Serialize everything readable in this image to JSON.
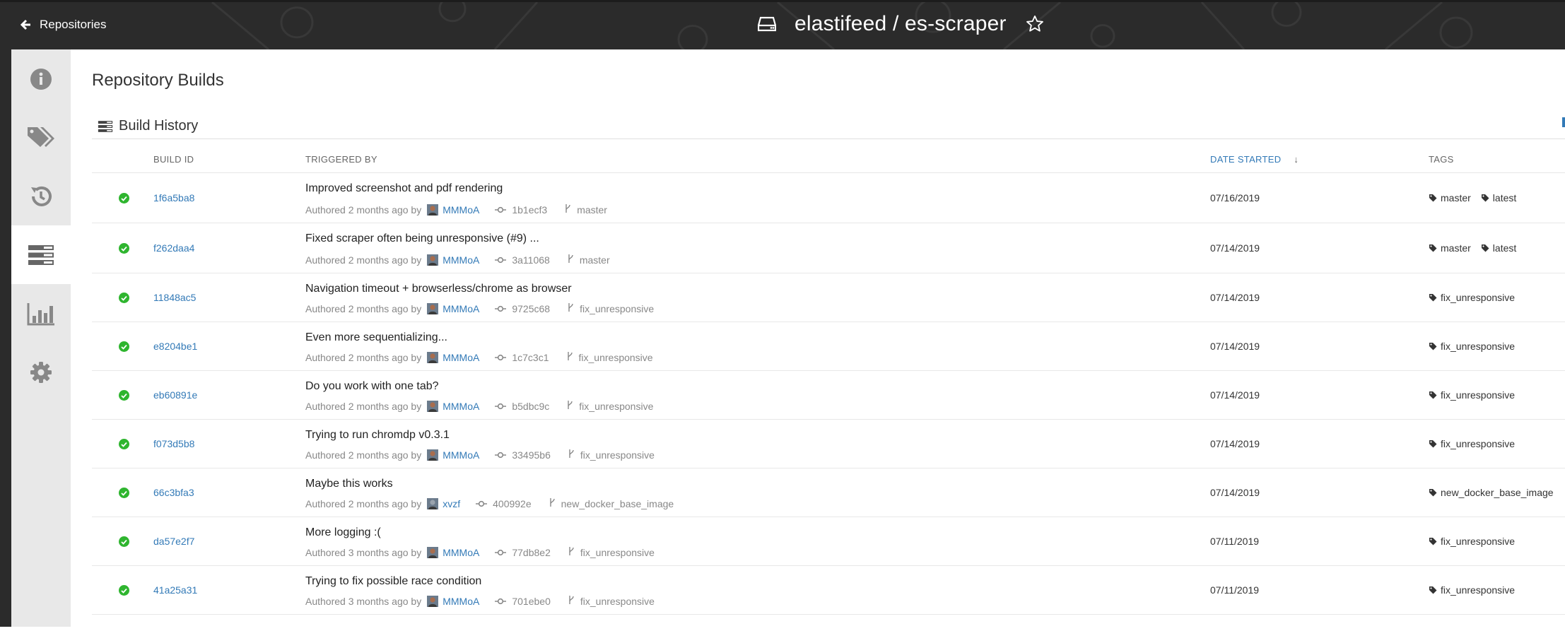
{
  "nav": {
    "back_label": "Repositories"
  },
  "header": {
    "repo_title": "elastifeed / es-scraper"
  },
  "sidebar": {
    "items": [
      {
        "icon": "info-icon"
      },
      {
        "icon": "tags-icon"
      },
      {
        "icon": "history-icon"
      },
      {
        "icon": "builds-icon",
        "active": true
      },
      {
        "icon": "bar-chart-icon"
      },
      {
        "icon": "gear-icon"
      }
    ]
  },
  "page": {
    "title": "Repository Builds"
  },
  "build_history": {
    "title": "Build History",
    "columns": {
      "build_id": "BUILD ID",
      "triggered_by": "TRIGGERED BY",
      "date_started": "DATE STARTED",
      "sort_indicator": "↓",
      "tags": "TAGS"
    },
    "rows": [
      {
        "id": "1f6a5ba8",
        "message": "Improved screenshot and pdf rendering",
        "authored": "Authored 2 months ago by",
        "author": "MMMoA",
        "commit": "1b1ecf3",
        "branch": "master",
        "date": "07/16/2019",
        "tags": [
          "master",
          "latest"
        ]
      },
      {
        "id": "f262daa4",
        "message": "Fixed scraper often being unresponsive (#9) ...",
        "authored": "Authored 2 months ago by",
        "author": "MMMoA",
        "commit": "3a11068",
        "branch": "master",
        "date": "07/14/2019",
        "tags": [
          "master",
          "latest"
        ]
      },
      {
        "id": "11848ac5",
        "message": "Navigation timeout + browserless/chrome as browser",
        "authored": "Authored 2 months ago by",
        "author": "MMMoA",
        "commit": "9725c68",
        "branch": "fix_unresponsive",
        "date": "07/14/2019",
        "tags": [
          "fix_unresponsive"
        ]
      },
      {
        "id": "e8204be1",
        "message": "Even more sequentializing...",
        "authored": "Authored 2 months ago by",
        "author": "MMMoA",
        "commit": "1c7c3c1",
        "branch": "fix_unresponsive",
        "date": "07/14/2019",
        "tags": [
          "fix_unresponsive"
        ]
      },
      {
        "id": "eb60891e",
        "message": "Do you work with one tab?",
        "authored": "Authored 2 months ago by",
        "author": "MMMoA",
        "commit": "b5dbc9c",
        "branch": "fix_unresponsive",
        "date": "07/14/2019",
        "tags": [
          "fix_unresponsive"
        ]
      },
      {
        "id": "f073d5b8",
        "message": "Trying to run chromdp v0.3.1",
        "authored": "Authored 2 months ago by",
        "author": "MMMoA",
        "commit": "33495b6",
        "branch": "fix_unresponsive",
        "date": "07/14/2019",
        "tags": [
          "fix_unresponsive"
        ]
      },
      {
        "id": "66c3bfa3",
        "message": "Maybe this works",
        "authored": "Authored 2 months ago by",
        "author": "xvzf",
        "commit": "400992e",
        "branch": "new_docker_base_image",
        "date": "07/14/2019",
        "tags": [
          "new_docker_base_image"
        ]
      },
      {
        "id": "da57e2f7",
        "message": "More logging :(",
        "authored": "Authored 3 months ago by",
        "author": "MMMoA",
        "commit": "77db8e2",
        "branch": "fix_unresponsive",
        "date": "07/11/2019",
        "tags": [
          "fix_unresponsive"
        ]
      },
      {
        "id": "41a25a31",
        "message": "Trying to fix possible race condition",
        "authored": "Authored 3 months ago by",
        "author": "MMMoA",
        "commit": "701ebe0",
        "branch": "fix_unresponsive",
        "date": "07/11/2019",
        "tags": [
          "fix_unresponsive"
        ]
      }
    ]
  },
  "colors": {
    "link": "#337ab7",
    "success": "#2fb52f",
    "topbar": "#2b2b2b",
    "sidebar": "#e8e8e8"
  }
}
